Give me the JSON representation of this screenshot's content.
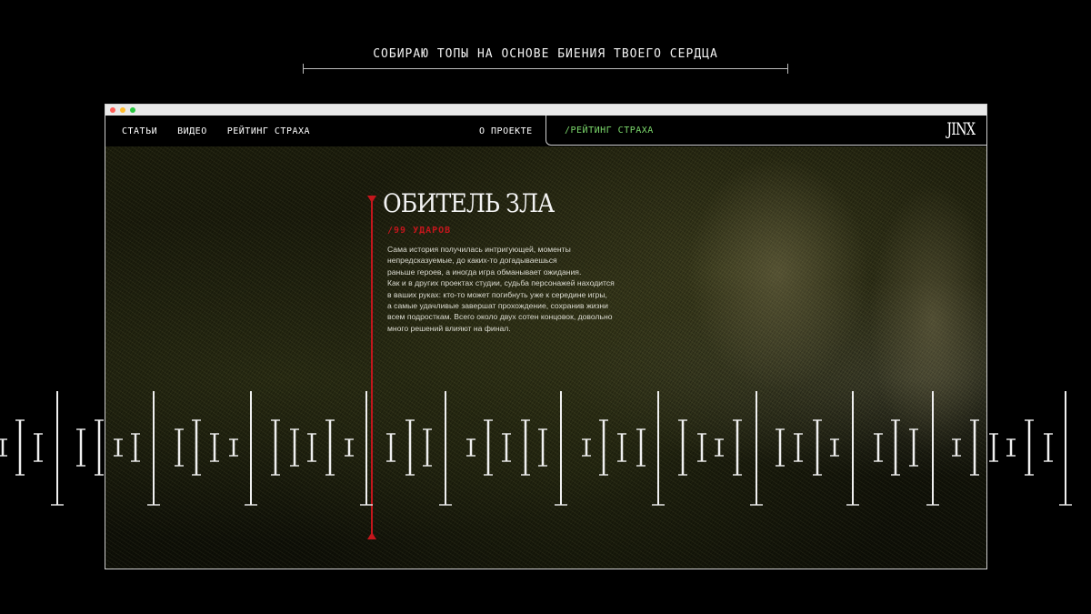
{
  "tagline": "СОБИРАЮ ТОПЫ НА ОСНОВЕ БИЕНИЯ ТВОЕГО СЕРДЦА",
  "nav": {
    "items": [
      {
        "label": "СТАТЬИ"
      },
      {
        "label": "ВИДЕО"
      },
      {
        "label": "РЕЙТИНГ СТРАХА"
      }
    ],
    "about": "О ПРОЕКТЕ",
    "breadcrumb": "/РЕЙТИНГ СТРАХА",
    "logo": "JINX"
  },
  "game": {
    "title": "ОБИТЕЛЬ ЗЛА",
    "beats": "/99 УДАРОВ",
    "description": [
      "Сама история получилась интригующей, моменты",
      "непредсказуемые, до каких-то догадываешься",
      "раньше героев, а иногда игра обманывает ожидания.",
      "Как и в других проектах студии, судьба персонажей находится",
      "в ваших руках: кто-то может погибнуть уже к середине игры,",
      "а самые удачливые завершат прохождение, сохранив жизни",
      "всем подросткам. Всего около двух сотен концовок, довольно",
      "много решений влияют на финал."
    ]
  },
  "colors": {
    "accent_red": "#c4161c",
    "breadcrumb_green": "#7bd86b",
    "background": "#000000"
  },
  "icons": {
    "window_controls": [
      "close-dot",
      "minimize-dot",
      "maximize-dot"
    ]
  }
}
